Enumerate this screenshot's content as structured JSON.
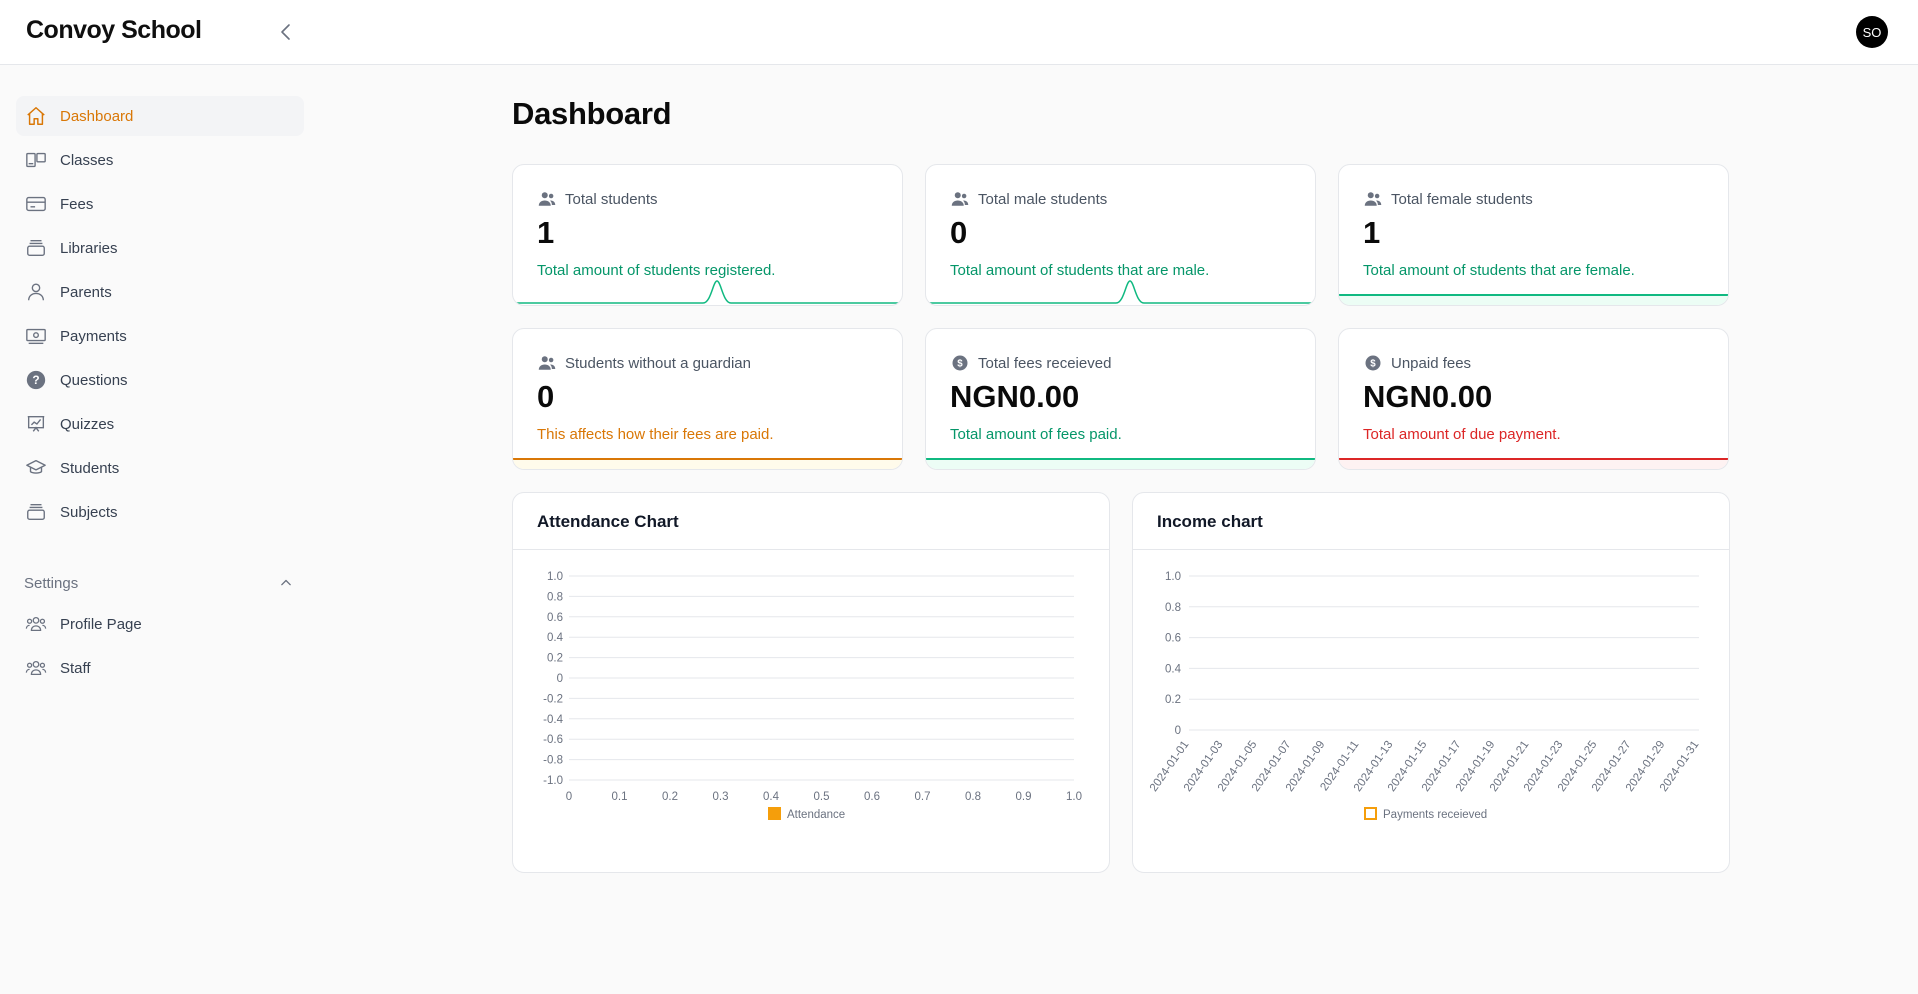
{
  "app": {
    "brand": "Convoy School",
    "avatar_initials": "SO"
  },
  "sidebar": {
    "items": [
      {
        "label": "Dashboard",
        "icon": "home-icon",
        "active": true
      },
      {
        "label": "Classes",
        "icon": "classes-icon"
      },
      {
        "label": "Fees",
        "icon": "credit-card-icon"
      },
      {
        "label": "Libraries",
        "icon": "library-icon"
      },
      {
        "label": "Parents",
        "icon": "user-icon"
      },
      {
        "label": "Payments",
        "icon": "banknote-icon"
      },
      {
        "label": "Questions",
        "icon": "question-circle-icon"
      },
      {
        "label": "Quizzes",
        "icon": "presentation-chart-icon"
      },
      {
        "label": "Students",
        "icon": "graduation-cap-icon"
      },
      {
        "label": "Subjects",
        "icon": "library-icon"
      }
    ],
    "settings": {
      "label": "Settings",
      "expanded": true,
      "items": [
        {
          "label": "Profile Page",
          "icon": "users-group-icon"
        },
        {
          "label": "Staff",
          "icon": "users-group-icon"
        }
      ]
    }
  },
  "page": {
    "title": "Dashboard"
  },
  "stats": [
    {
      "label": "Total students",
      "value": "1",
      "description": "Total amount of students registered.",
      "icon": "users-icon",
      "color": "#059669"
    },
    {
      "label": "Total male students",
      "value": "0",
      "description": "Total amount of students that are male.",
      "icon": "users-icon",
      "color": "#059669"
    },
    {
      "label": "Total female students",
      "value": "1",
      "description": "Total amount of students that are female.",
      "icon": "users-icon",
      "color": "#059669"
    },
    {
      "label": "Students without a guardian",
      "value": "0",
      "description": "This affects how their fees are paid.",
      "icon": "users-icon",
      "color": "#d97706"
    },
    {
      "label": "Total fees receieved",
      "value": "NGN0.00",
      "description": "Total amount of fees paid.",
      "icon": "dollar-circle-icon",
      "color": "#059669"
    },
    {
      "label": "Unpaid fees",
      "value": "NGN0.00",
      "description": "Total amount of due payment.",
      "icon": "dollar-circle-icon",
      "color": "#dc2626"
    }
  ],
  "colors": {
    "accent": "#d97706",
    "success": "#059669",
    "danger": "#dc2626",
    "attendance": "#f59e0b"
  },
  "chart_data": [
    {
      "type": "bar",
      "title": "Attendance Chart",
      "x_ticks": [
        "0",
        "0.1",
        "0.2",
        "0.3",
        "0.4",
        "0.5",
        "0.6",
        "0.7",
        "0.8",
        "0.9",
        "1.0"
      ],
      "y_ticks": [
        "1.0",
        "0.8",
        "0.6",
        "0.4",
        "0.2",
        "0",
        "-0.2",
        "-0.4",
        "-0.6",
        "-0.8",
        "-1.0"
      ],
      "ylim": [
        -1,
        1
      ],
      "xlim": [
        0,
        1
      ],
      "grid": true,
      "series": [
        {
          "name": "Attendance",
          "values": [],
          "color": "#f59e0b"
        }
      ],
      "legend": "bottom"
    },
    {
      "type": "line",
      "title": "Income chart",
      "categories": [
        "2024-01-01",
        "2024-01-03",
        "2024-01-05",
        "2024-01-07",
        "2024-01-09",
        "2024-01-11",
        "2024-01-13",
        "2024-01-15",
        "2024-01-17",
        "2024-01-19",
        "2024-01-21",
        "2024-01-23",
        "2024-01-25",
        "2024-01-27",
        "2024-01-29",
        "2024-01-31"
      ],
      "y_ticks": [
        "1.0",
        "0.8",
        "0.6",
        "0.4",
        "0.2",
        "0"
      ],
      "ylim": [
        0,
        1
      ],
      "grid": true,
      "series": [
        {
          "name": "Payments receieved",
          "values": [
            0,
            0,
            0,
            0,
            0,
            0,
            0,
            0,
            0,
            0,
            0,
            0,
            0,
            0,
            0,
            0
          ],
          "color": "#f59e0b"
        }
      ],
      "legend": "bottom"
    }
  ]
}
